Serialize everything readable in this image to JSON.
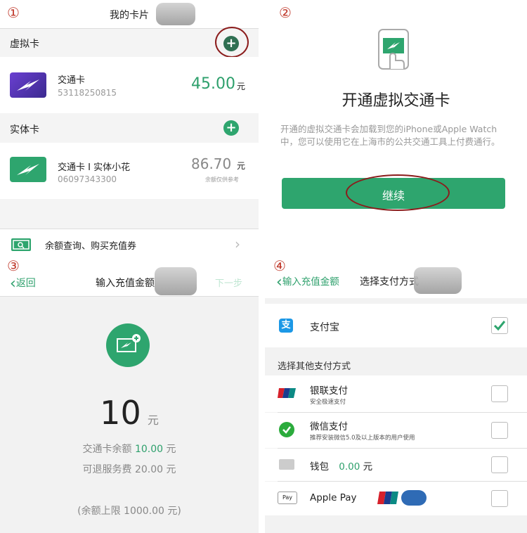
{
  "p1": {
    "step": "①",
    "title": "我的卡片",
    "virtual_section": "虚拟卡",
    "virtual_card": {
      "name": "交通卡",
      "number": "53118250815",
      "balance": "45.00",
      "unit": "元"
    },
    "physical_section": "实体卡",
    "physical_card": {
      "name": "交通卡 I 实体小花",
      "number": "06097343300",
      "balance": "86.70",
      "unit": "元",
      "note": "余额仅供参考"
    },
    "link": "余额查询、购买充值券"
  },
  "p2": {
    "step": "②",
    "title": "开通虚拟交通卡",
    "desc": "开通的虚拟交通卡会加载到您的iPhone或Apple Watch中，您可以使用它在上海市的公共交通工具上付费通行。",
    "button": "继续"
  },
  "p3": {
    "step": "③",
    "back": "返回",
    "title": "输入充值金额",
    "next": "下一步",
    "amount": "10",
    "amount_unit": "元",
    "balance_label": "交通卡余额",
    "balance_value": "10.00",
    "balance_unit": "元",
    "fee": "可退服务费 20.00 元",
    "limit": "(余额上限 1000.00 元)"
  },
  "p4": {
    "step": "④",
    "back": "输入充值金额",
    "title": "选择支付方式",
    "alipay": "支付宝",
    "other_header": "选择其他支付方式",
    "unionpay": {
      "label": "银联支付",
      "sub": "安全极速支付"
    },
    "wechat": {
      "label": "微信支付",
      "sub": "推荐安装微信5.0及以上版本的用户使用"
    },
    "wallet": {
      "label": "钱包",
      "value": "0.00",
      "unit": "元"
    },
    "applepay": {
      "label": "Apple Pay",
      "badge": "Pay",
      "unionpay_badge": "UnionPay 银联",
      "quickpass_badge": "Quick Pass"
    }
  },
  "colors": {
    "accent": "#2ea56e",
    "annotation": "#8b1c1c"
  }
}
